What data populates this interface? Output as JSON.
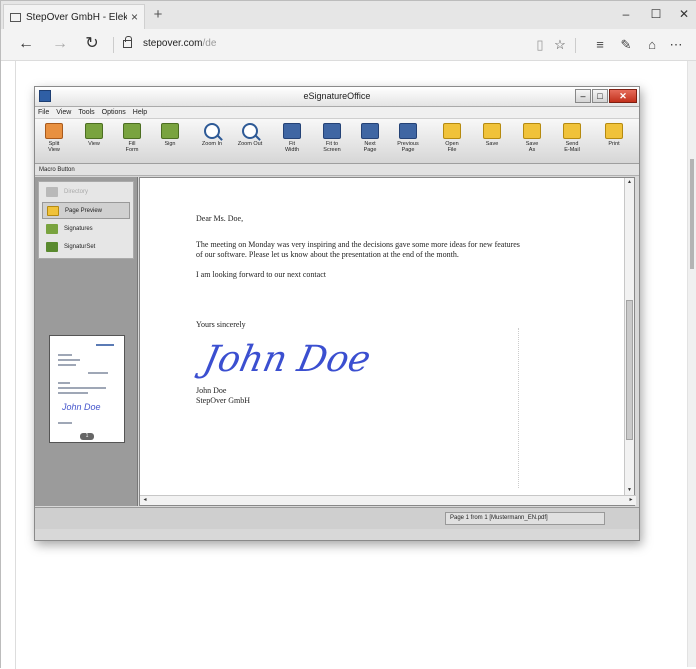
{
  "browser": {
    "tab_title": "StepOver GmbH - Elektr",
    "tab_close": "×",
    "new_tab": "+",
    "window_controls": [
      "–",
      "☐",
      "✕"
    ],
    "url_host": "stepover.com",
    "url_path": "/de",
    "icons": {
      "back": "←",
      "forward": "→",
      "refresh": "↻",
      "reading": "▯",
      "favorite": "☆",
      "hub": "≡",
      "notes": "✎",
      "share": "⌂",
      "more": "⋯"
    }
  },
  "app": {
    "title": "eSignatureOffice",
    "window_buttons": {
      "minimize": "–",
      "maximize": "□",
      "close": "✕"
    },
    "menu": [
      "File",
      "View",
      "Tools",
      "Options",
      "Help"
    ],
    "toolbar": [
      {
        "label": "Split\nView",
        "icon": "split-view-icon",
        "color": "orange"
      },
      {
        "label": "View",
        "icon": "view-icon",
        "color": "green"
      },
      {
        "label": "Fill\nForm",
        "icon": "fill-form-icon",
        "color": "green"
      },
      {
        "label": "Sign",
        "icon": "sign-icon",
        "color": "green"
      },
      {
        "label": "Zoom In",
        "icon": "zoom-in-icon",
        "color": "zoom"
      },
      {
        "label": "Zoom Out",
        "icon": "zoom-out-icon",
        "color": "zoom"
      },
      {
        "label": "Fit\nWidth",
        "icon": "fit-width-icon",
        "color": "blue"
      },
      {
        "label": "Fit to\nScreen",
        "icon": "fit-screen-icon",
        "color": "blue"
      },
      {
        "label": "Next\nPage",
        "icon": "next-page-icon",
        "color": "blue"
      },
      {
        "label": "Previous\nPage",
        "icon": "previous-page-icon",
        "color": "blue"
      },
      {
        "label": "Open\nFile",
        "icon": "open-file-icon",
        "color": "yellow"
      },
      {
        "label": "Save",
        "icon": "save-icon",
        "color": "yellow"
      },
      {
        "label": "Save\nAs",
        "icon": "save-as-icon",
        "color": "yellow"
      },
      {
        "label": "Send\nE-Mail",
        "icon": "send-email-icon",
        "color": "yellow"
      },
      {
        "label": "Print",
        "icon": "print-icon",
        "color": "yellow"
      }
    ],
    "macro_label": "Macro Button",
    "sidebar": {
      "items": [
        {
          "label": "Directory",
          "icon": "directory-icon",
          "selected": false
        },
        {
          "label": "Page Preview",
          "icon": "page-preview-icon",
          "selected": true
        },
        {
          "label": "Signatures",
          "icon": "signatures-icon",
          "selected": false
        },
        {
          "label": "SignaturSet",
          "icon": "signature-set-icon",
          "selected": false
        }
      ],
      "thumb_page": "1"
    },
    "letter": {
      "greeting": "Dear Ms. Doe,",
      "body1": "The meeting on Monday was very inspiring and the decisions gave some more ideas for new features of our software. Please let us know about the presentation at the end of the month.",
      "body2": "I am looking forward to our next contact",
      "closing": "Yours sincerely",
      "signature": "John Doe",
      "name": "John Doe",
      "company": "StepOver GmbH"
    },
    "status": "Page 1 from 1  [Mustermann_EN.pdf]"
  },
  "colors": {
    "accent_red": "#c2311c",
    "signature_blue": "#3b4fd0",
    "toolbar_blue": "#3f66a3"
  }
}
